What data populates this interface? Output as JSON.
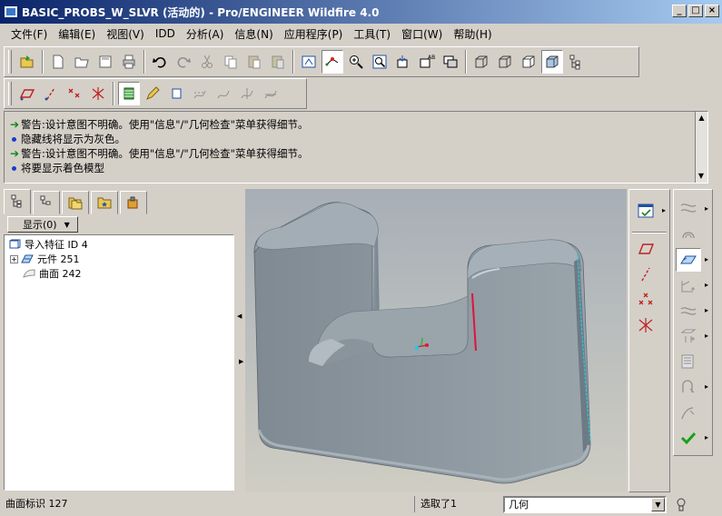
{
  "window": {
    "title": "BASIC_PROBS_W_SLVR (活动的) - Pro/ENGINEER Wildfire 4.0",
    "minimize": "_",
    "maximize": "□",
    "close": "×"
  },
  "menu": [
    "文件(F)",
    "编辑(E)",
    "视图(V)",
    "IDD",
    "分析(A)",
    "信息(N)",
    "应用程序(P)",
    "工具(T)",
    "窗口(W)",
    "帮助(H)"
  ],
  "messages": [
    {
      "kind": "warning",
      "text": "警告:设计意图不明确。使用\"信息\"/\"几何检查\"菜单获得细节。"
    },
    {
      "kind": "info",
      "text": "隐藏线将显示为灰色。"
    },
    {
      "kind": "warning",
      "text": "警告:设计意图不明确。使用\"信息\"/\"几何检查\"菜单获得细节。"
    },
    {
      "kind": "info",
      "text": "将要显示着色模型"
    }
  ],
  "tree": {
    "show_label": "显示(0)",
    "items": [
      {
        "label": "导入特征 ID 4",
        "expander": ""
      },
      {
        "label": "元件 251",
        "expander": "+"
      },
      {
        "label": "曲面 242",
        "expander": ""
      }
    ]
  },
  "status": {
    "left": "曲面标识 127",
    "selected": "选取了1",
    "filter_value": "几何"
  },
  "colors": {
    "titlebar_start": "#0a246a",
    "titlebar_end": "#a6caf0",
    "model": "#8f9aa3",
    "highlight_red": "#e0143c",
    "highlight_cyan": "#28c8e0"
  }
}
